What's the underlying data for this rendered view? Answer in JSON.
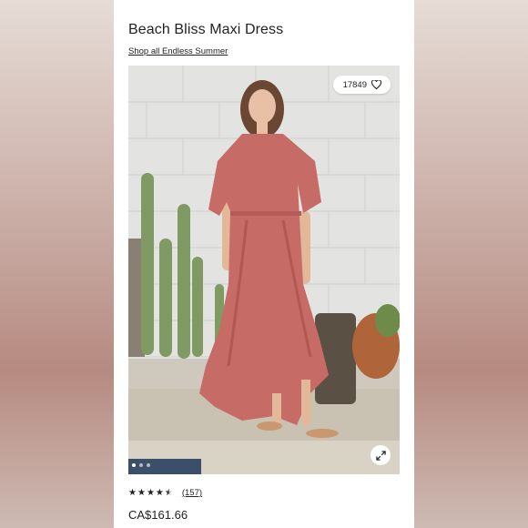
{
  "product": {
    "title": "Beach Bliss Maxi Dress",
    "collection_link": "Shop all Endless Summer",
    "likes": "17849",
    "rating": 4.5,
    "review_count": "(157)",
    "price": "CA$161.66"
  },
  "gallery": {
    "image_count": 3,
    "active_index": 0
  },
  "icons": {
    "like": "heart-icon",
    "expand": "expand-icon"
  },
  "colors": {
    "dress": "#c66b66",
    "background": "#d9ccc6",
    "card": "#ffffff",
    "text": "#222222"
  }
}
